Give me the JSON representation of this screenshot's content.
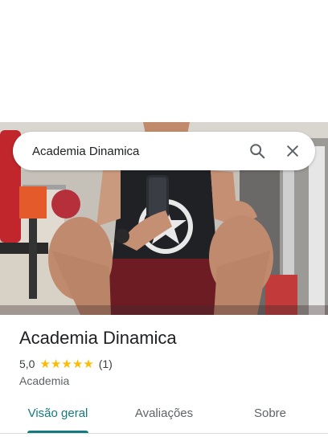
{
  "search": {
    "value": "Academia Dinamica",
    "search_icon": "search-icon",
    "clear_icon": "close-icon"
  },
  "place": {
    "name": "Academia Dinamica",
    "rating": "5,0",
    "stars": 5,
    "reviews": "(1)",
    "category": "Academia"
  },
  "tabs": [
    {
      "label": "Visão geral",
      "active": true
    },
    {
      "label": "Avaliações",
      "active": false
    },
    {
      "label": "Sobre",
      "active": false
    }
  ],
  "colors": {
    "accent": "#137a7f",
    "star": "#fbbc04"
  }
}
